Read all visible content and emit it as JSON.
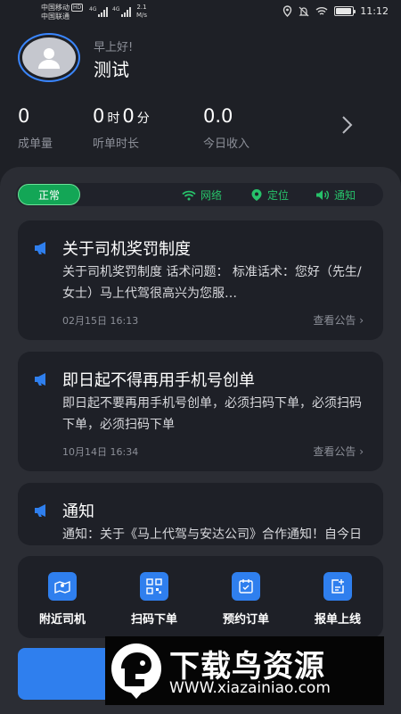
{
  "status_bar": {
    "carrier1": "中国移动",
    "carrier1_badge": "HD",
    "carrier2": "中国联通",
    "net1": "4G",
    "net2": "4G",
    "speed_value": "2.1",
    "speed_unit": "M/s",
    "time": "11:12"
  },
  "header": {
    "greeting": "早上好!",
    "username": "测试"
  },
  "stats": {
    "orders_value": "0",
    "orders_label": "成单量",
    "hours_value": "0",
    "hours_unit": "时",
    "minutes_value": "0",
    "minutes_unit": "分",
    "duration_label": "听单时长",
    "income_value": "0.0",
    "income_label": "今日收入"
  },
  "status_row": {
    "state": "正常",
    "network": "网络",
    "location": "定位",
    "notify": "通知"
  },
  "notices": [
    {
      "title": "关于司机奖罚制度",
      "body": "关于司机奖罚制度 话术问题： 标准话术：您好（先生/女士）马上代驾很高兴为您服…",
      "date": "02月15日  16:13",
      "link": "查看公告"
    },
    {
      "title": "即日起不得再用手机号创单",
      "body": "即日起不要再用手机号创单，必须扫码下单，必须扫码下单，必须扫码下单",
      "date": "10月14日  16:34",
      "link": "查看公告"
    },
    {
      "title": "通知",
      "body": "通知：关于《马上代驾与安达公司》合作通知！自今日起马上代驾与安达公司达成战",
      "date": "",
      "link": ""
    }
  ],
  "tools": [
    {
      "label": "附近司机",
      "icon": "nearby-drivers-icon"
    },
    {
      "label": "扫码下单",
      "icon": "qr-code-icon"
    },
    {
      "label": "预约订单",
      "icon": "reservation-icon"
    },
    {
      "label": "报单上线",
      "icon": "report-order-icon"
    }
  ],
  "watermark": {
    "title": "下载鸟资源",
    "url": "WWW.xiazainiao.com"
  },
  "colors": {
    "accent": "#2f7fee",
    "ok_green": "#27c26a",
    "card_bg": "#1e2027",
    "sheet_bg": "#2b2d34"
  }
}
